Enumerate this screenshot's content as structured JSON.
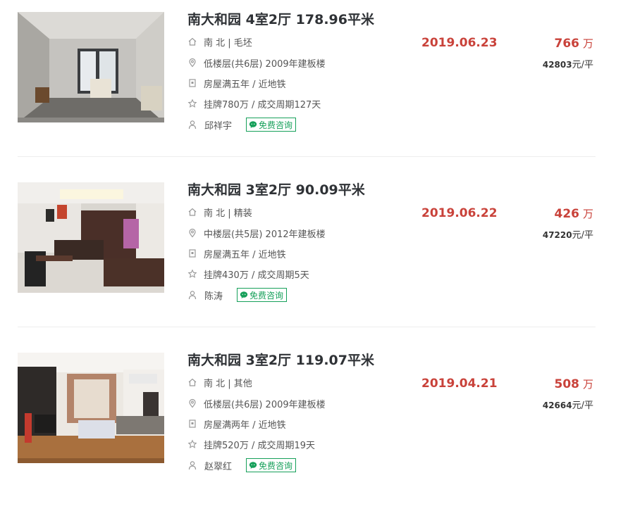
{
  "listings": [
    {
      "title": "南大和园 4室2厅 178.96平米",
      "house_info": "南 北 | 毛坯",
      "position_info": "低楼层(共6层) 2009年建板楼",
      "tags": "房屋满五年 / 近地铁",
      "deal_cycle": "挂牌780万 / 成交周期127天",
      "agent": "邱祥宇",
      "consult_label": "免费咨询",
      "deal_date": "2019.06.23",
      "total_price": "766",
      "total_unit": "万",
      "unit_price_num": "42803",
      "unit_price_suffix": "元/平"
    },
    {
      "title": "南大和园 3室2厅 90.09平米",
      "house_info": "南 北 | 精装",
      "position_info": "中楼层(共5层) 2012年建板楼",
      "tags": "房屋满五年 / 近地铁",
      "deal_cycle": "挂牌430万 / 成交周期5天",
      "agent": "陈涛",
      "consult_label": "免费咨询",
      "deal_date": "2019.06.22",
      "total_price": "426",
      "total_unit": "万",
      "unit_price_num": "47220",
      "unit_price_suffix": "元/平"
    },
    {
      "title": "南大和园 3室2厅 119.07平米",
      "house_info": "南 北 | 其他",
      "position_info": "低楼层(共6层) 2009年建板楼",
      "tags": "房屋满两年 / 近地铁",
      "deal_cycle": "挂牌520万 / 成交周期19天",
      "agent": "赵翠红",
      "consult_label": "免费咨询",
      "deal_date": "2019.04.21",
      "total_price": "508",
      "total_unit": "万",
      "unit_price_num": "42664",
      "unit_price_suffix": "元/平"
    }
  ],
  "colors": {
    "accent_red": "#c9423a",
    "wechat_green": "#16a05a",
    "title_text": "#2f3236"
  },
  "icons": {
    "house_info": "house-icon",
    "position_info": "location-pin-icon",
    "tags": "shield-icon",
    "deal_cycle": "star-icon",
    "agent": "person-icon",
    "consult": "wechat-icon"
  }
}
